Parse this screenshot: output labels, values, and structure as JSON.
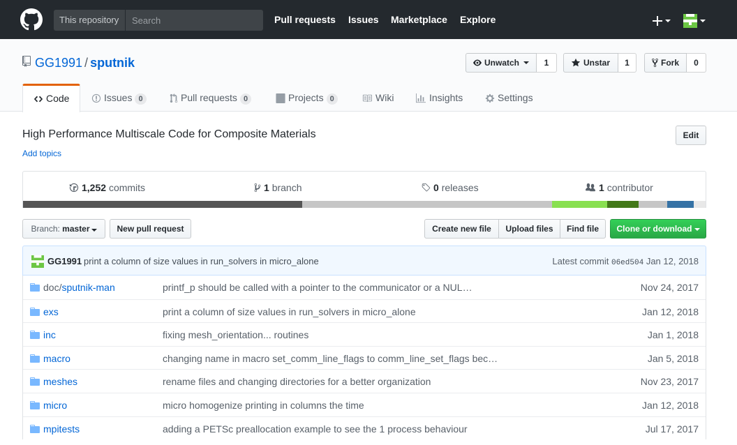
{
  "header": {
    "scope_label": "This repository",
    "search_placeholder": "Search",
    "nav": [
      "Pull requests",
      "Issues",
      "Marketplace",
      "Explore"
    ],
    "plus_label": "+"
  },
  "repo": {
    "owner": "GG1991",
    "separator": "/",
    "name": "sputnik"
  },
  "actions": {
    "watch_label": "Unwatch",
    "watch_count": "1",
    "star_label": "Unstar",
    "star_count": "1",
    "fork_label": "Fork",
    "fork_count": "0"
  },
  "tabs": [
    {
      "label": "Code",
      "icon": "code-icon"
    },
    {
      "label": "Issues",
      "count": "0",
      "icon": "issue-icon"
    },
    {
      "label": "Pull requests",
      "count": "0",
      "icon": "pull-request-icon"
    },
    {
      "label": "Projects",
      "count": "0",
      "icon": "project-icon"
    },
    {
      "label": "Wiki",
      "icon": "book-icon"
    },
    {
      "label": "Insights",
      "icon": "graph-icon"
    },
    {
      "label": "Settings",
      "icon": "gear-icon"
    }
  ],
  "description": "High Performance Multiscale Code for Composite Materials",
  "add_topics": "Add topics",
  "edit_label": "Edit",
  "summary": {
    "commits_count": "1,252",
    "commits_label": "commits",
    "branches_count": "1",
    "branches_label": "branch",
    "releases_count": "0",
    "releases_label": "releases",
    "contributors_count": "1",
    "contributors_label": "contributor"
  },
  "language_bar": [
    {
      "color": "#555555",
      "percent": 40.9
    },
    {
      "color": "#c6c6c6",
      "percent": 36.6
    },
    {
      "color": "#89e051",
      "percent": 8.1
    },
    {
      "color": "#427819",
      "percent": 4.6
    },
    {
      "color": "#c6c6c6",
      "percent": 4.2
    },
    {
      "color": "#3572a5",
      "percent": 3.9
    },
    {
      "color": "#e8e8e8",
      "percent": 1.7
    }
  ],
  "file_nav": {
    "branch_prefix": "Branch:",
    "branch_name": "master",
    "new_pull_request": "New pull request",
    "create_new_file": "Create new file",
    "upload_files": "Upload files",
    "find_file": "Find file",
    "clone_or_download": "Clone or download"
  },
  "latest_commit": {
    "author": "GG1991",
    "message": "print a column of size values in run_solvers in micro_alone",
    "label": "Latest commit",
    "sha": "06ed504",
    "date": "Jan 12, 2018"
  },
  "files": [
    {
      "prefix": "doc/",
      "name": "sputnik-man",
      "message": "printf_p should be called with a pointer to the communicator or a NUL…",
      "age": "Nov 24, 2017"
    },
    {
      "prefix": "",
      "name": "exs",
      "message": "print a column of size values in run_solvers in micro_alone",
      "age": "Jan 12, 2018"
    },
    {
      "prefix": "",
      "name": "inc",
      "message": "fixing mesh_orientation... routines",
      "age": "Jan 1, 2018"
    },
    {
      "prefix": "",
      "name": "macro",
      "message": "changing name in macro set_comm_line_flags to comm_line_set_flags bec…",
      "age": "Jan 5, 2018"
    },
    {
      "prefix": "",
      "name": "meshes",
      "message": "rename files and changing directories for a better organization",
      "age": "Nov 23, 2017"
    },
    {
      "prefix": "",
      "name": "micro",
      "message": "micro homogenize printing in columns the time",
      "age": "Jan 12, 2018"
    },
    {
      "prefix": "",
      "name": "mpitests",
      "message": "adding a PETSc preallocation example to see the 1 process behaviour",
      "age": "Jul 17, 2017"
    }
  ]
}
